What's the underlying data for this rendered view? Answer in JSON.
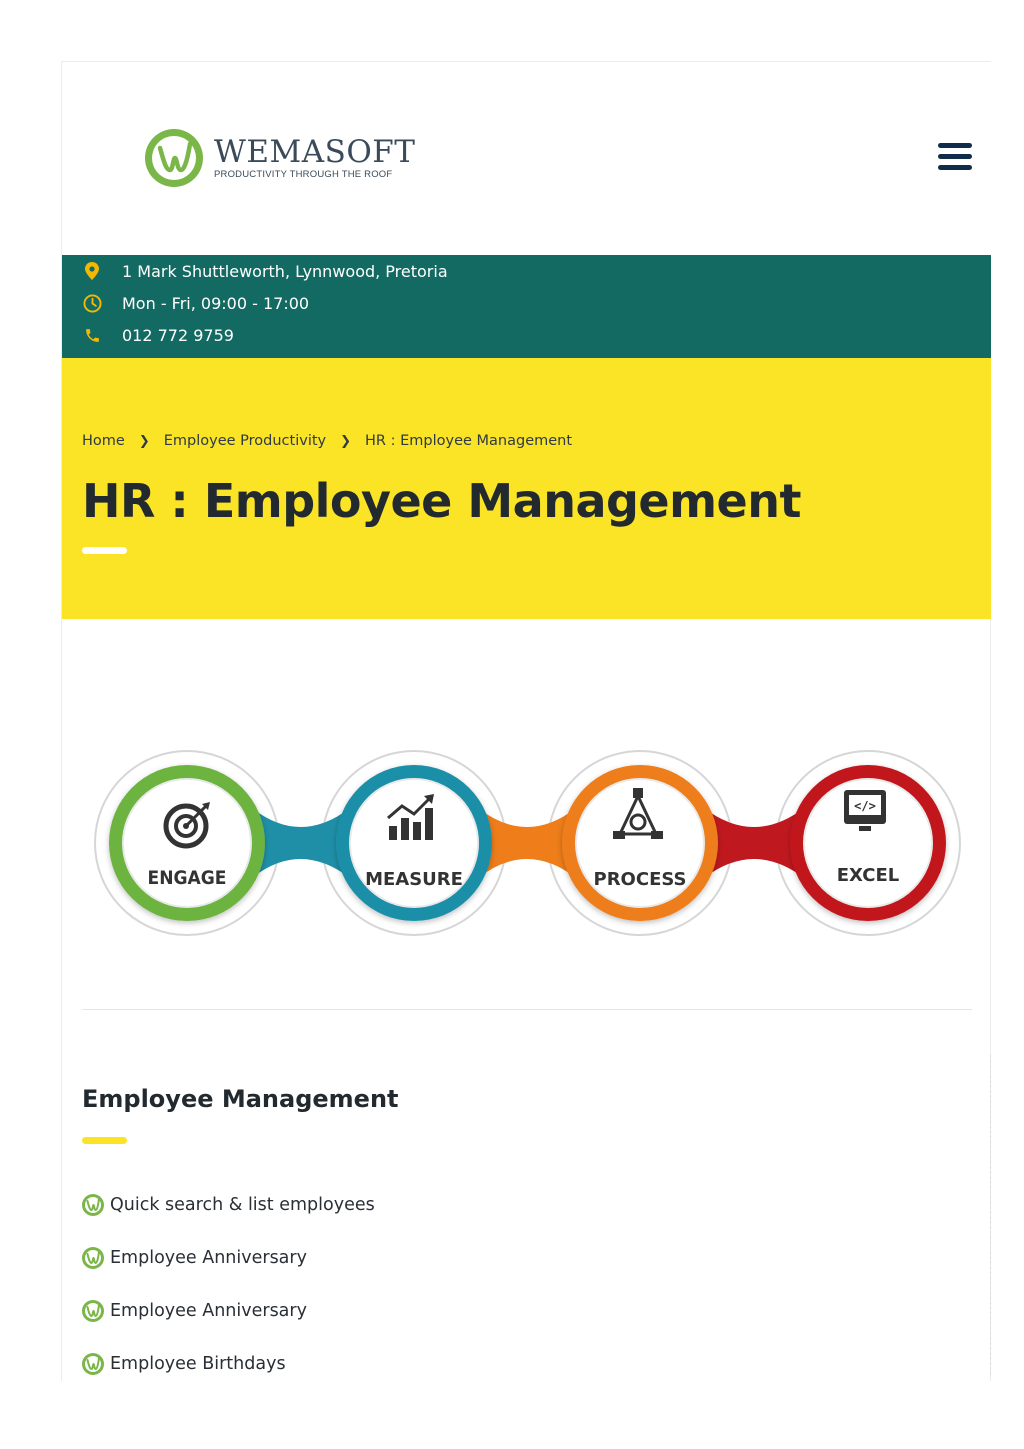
{
  "brand": {
    "name": "WEMASOFT",
    "tagline": "PRODUCTIVITY THROUGH THE ROOF",
    "logo_letter": "W",
    "colors": {
      "green": "#7ab648",
      "navy": "#0f2d4a",
      "teal": "#136a62",
      "yellow": "#fbe326"
    }
  },
  "header": {
    "menu_icon": "hamburger-menu-icon"
  },
  "contact": {
    "address": "1 Mark Shuttleworth, Lynnwood, Pretoria",
    "hours": "Mon - Fri, 09:00 - 17:00",
    "phone": "012 772 9759",
    "icon_color": "#f5b800"
  },
  "breadcrumb": {
    "items": [
      "Home",
      "Employee Productivity",
      "HR : Employee Management"
    ]
  },
  "page": {
    "title": "HR : Employee Management"
  },
  "process": {
    "steps": [
      {
        "label": "ENGAGE",
        "icon": "target-icon",
        "color": "#6db33f"
      },
      {
        "label": "MEASURE",
        "icon": "bar-chart-icon",
        "color": "#1f8fa8"
      },
      {
        "label": "PROCESS",
        "icon": "process-triangle-icon",
        "color": "#ee7d1a"
      },
      {
        "label": "EXCEL",
        "icon": "monitor-code-icon",
        "color": "#c0181f"
      }
    ]
  },
  "features": {
    "title": "Employee Management",
    "items": [
      "Quick search & list employees",
      "Employee Anniversary",
      "Employee Anniversary",
      "Employee Birthdays"
    ]
  }
}
